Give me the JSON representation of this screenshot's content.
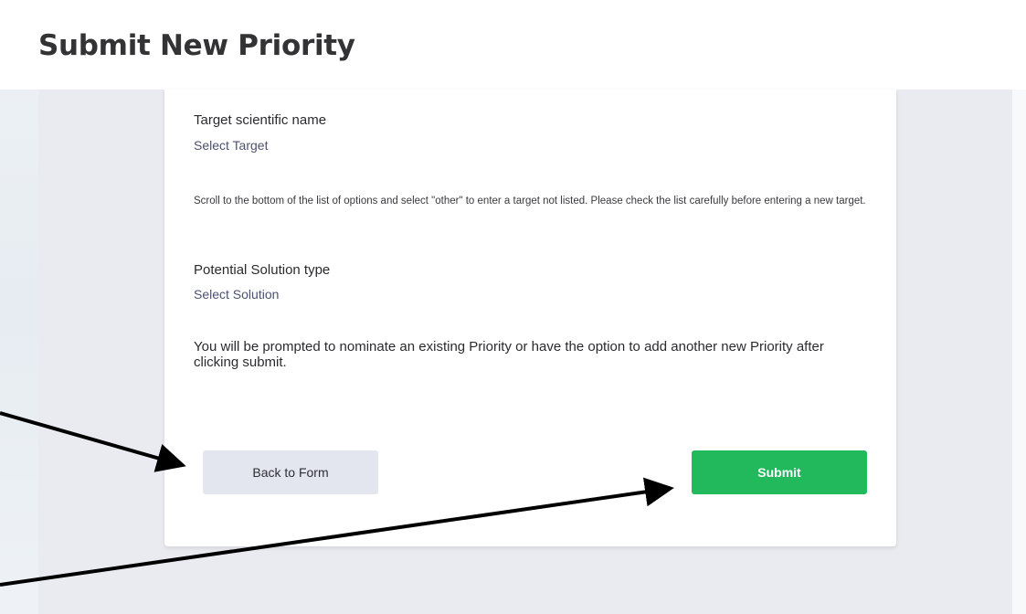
{
  "header": {
    "title": "Submit New Priority"
  },
  "form": {
    "target_label": "Target scientific name",
    "target_select": "Select Target",
    "target_help": "Scroll to the bottom of the list of options and select \"other\" to enter a target not listed. Please check the list carefully before entering a new target.",
    "solution_label": "Potential Solution type",
    "solution_select": "Select Solution",
    "prompt": "You will be prompted to nominate an existing Priority or have the option to add another new Priority after clicking submit."
  },
  "buttons": {
    "back_label": "Back to Form",
    "submit_label": "Submit"
  },
  "colors": {
    "submit_green": "#22b85c",
    "back_button_bg": "#e3e5ef",
    "content_bg": "#e9ebf0",
    "arrow": "#000000"
  },
  "icons": [
    "annotation-arrow-back",
    "annotation-arrow-submit"
  ]
}
